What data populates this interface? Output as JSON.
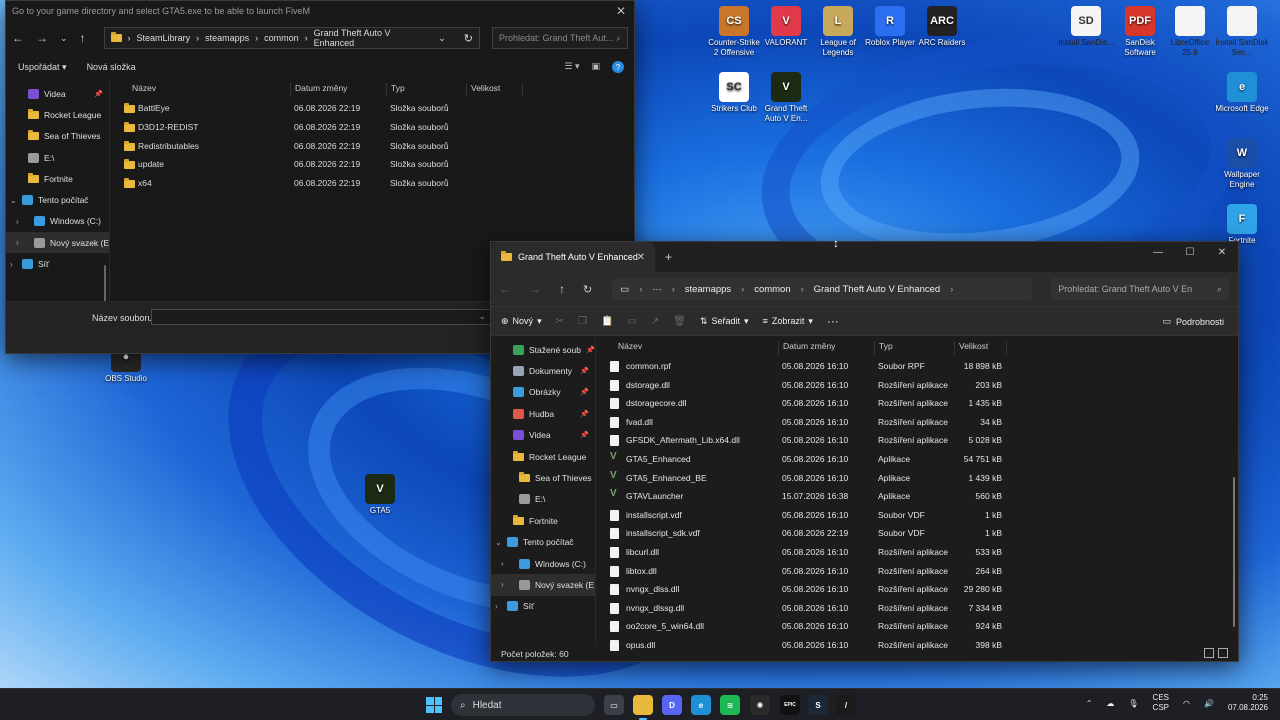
{
  "desktop": {
    "icons": [
      {
        "label": "Counter-Strike 2 Offensive",
        "color": "#c9762a",
        "abbr": "CS"
      },
      {
        "label": "VALORANT",
        "color": "#e0394a",
        "abbr": "V"
      },
      {
        "label": "League of Legends",
        "color": "#c8a85a",
        "abbr": "L"
      },
      {
        "label": "Roblox Player",
        "color": "#2b6ff0",
        "abbr": "R"
      },
      {
        "label": "ARC Raiders",
        "color": "#222222",
        "abbr": "ARC"
      },
      {
        "label": "Install SanDis...",
        "color": "#f5f5f5",
        "abbr": "SD"
      },
      {
        "label": "SanDisk Software",
        "color": "#d8362b",
        "abbr": "PDF"
      },
      {
        "label": "LibreOffice 25.8",
        "color": "#f5f5f5",
        "abbr": ""
      },
      {
        "label": "Install SanDisk Sec...",
        "color": "#f5f5f5",
        "abbr": ""
      },
      {
        "label": "Strikers Club",
        "color": "#ffffff",
        "abbr": "SC"
      },
      {
        "label": "Grand Theft Auto V En...",
        "color": "#1c2a14",
        "abbr": "V"
      },
      {
        "label": "Microsoft Edge",
        "color": "#1f8fd6",
        "abbr": "e"
      },
      {
        "label": "Wallpaper Engine",
        "color": "#1a4fa8",
        "abbr": "W"
      },
      {
        "label": "Fortnite",
        "color": "#2fa4e8",
        "abbr": "F"
      },
      {
        "label": "OBS Studio",
        "color": "#2a2a2a",
        "abbr": "●"
      },
      {
        "label": "GTA5",
        "color": "#1c2a14",
        "abbr": "V"
      }
    ]
  },
  "dialog": {
    "title": "Go to your game directory and select GTA5.exe to be able to launch FiveM",
    "close": "✕",
    "breadcrumb": [
      "SteamLibrary",
      "steamapps",
      "common",
      "Grand Theft Auto V Enhanced"
    ],
    "search_placeholder": "Prohledat: Grand Theft Aut...",
    "organize": "Uspořádat",
    "new_folder": "Nová složka",
    "sidebar": [
      {
        "label": "Videa",
        "color": "#7a4fd6",
        "pin": true
      },
      {
        "label": "Rocket League",
        "folder": true
      },
      {
        "label": "Sea of Thieves",
        "folder": true
      },
      {
        "label": "E:\\",
        "color": "#9a9a9a"
      },
      {
        "label": "Fortnite",
        "folder": true
      },
      {
        "label": "Tento počítač",
        "color": "#3a9be0",
        "top": true
      },
      {
        "label": "Windows (C:)",
        "color": "#3a9be0"
      },
      {
        "label": "Nový svazek (E",
        "color": "#9a9a9a",
        "selected": true
      },
      {
        "label": "Síť",
        "color": "#3a9be0",
        "top": true
      }
    ],
    "columns": [
      "Název",
      "Datum změny",
      "Typ",
      "Velikost"
    ],
    "rows": [
      {
        "name": "BattlEye",
        "date": "06.08.2026 22:19",
        "type": "Složka souborů"
      },
      {
        "name": "D3D12-REDIST",
        "date": "06.08.2026 22:19",
        "type": "Složka souborů"
      },
      {
        "name": "Redistributables",
        "date": "06.08.2026 22:19",
        "type": "Složka souborů"
      },
      {
        "name": "update",
        "date": "06.08.2026 22:19",
        "type": "Složka souborů"
      },
      {
        "name": "x64",
        "date": "06.08.2026 22:19",
        "type": "Složka souborů"
      }
    ],
    "filename_label": "Název souboru:",
    "filename_value": ""
  },
  "explorer": {
    "tab_title": "Grand Theft Auto V Enhanced",
    "breadcrumb": [
      "steamapps",
      "common",
      "Grand Theft Auto V Enhanced"
    ],
    "search_placeholder": "Prohledat: Grand Theft Auto V En",
    "cmd": {
      "new": "Nový",
      "sort": "Seřadit",
      "view": "Zobrazit",
      "details": "Podrobnosti"
    },
    "sidebar": [
      {
        "label": "Stažené soub",
        "color": "#3aa35a",
        "pin": true
      },
      {
        "label": "Dokumenty",
        "color": "#9aa4b8",
        "pin": true
      },
      {
        "label": "Obrázky",
        "color": "#3a9be0",
        "pin": true
      },
      {
        "label": "Hudba",
        "color": "#e05a4a",
        "pin": true
      },
      {
        "label": "Videa",
        "color": "#7a4fd6",
        "pin": true
      },
      {
        "label": "Rocket League",
        "folder": true
      },
      {
        "label": "Sea of Thieves",
        "folder": true
      },
      {
        "label": "E:\\",
        "color": "#9a9a9a"
      },
      {
        "label": "Fortnite",
        "folder": true
      },
      {
        "label": "Tento počítač",
        "color": "#3a9be0",
        "top": true
      },
      {
        "label": "Windows (C:)",
        "color": "#3a9be0"
      },
      {
        "label": "Nový svazek (E",
        "color": "#9a9a9a",
        "selected": true
      },
      {
        "label": "Síť",
        "color": "#3a9be0",
        "top": true
      }
    ],
    "columns": [
      "Název",
      "Datum změny",
      "Typ",
      "Velikost"
    ],
    "rows": [
      {
        "name": "common.rpf",
        "date": "05.08.2026 16:10",
        "type": "Soubor RPF",
        "size": "18 898 kB",
        "icon": "file"
      },
      {
        "name": "dstorage.dll",
        "date": "05.08.2026 16:10",
        "type": "Rozšíření aplikace",
        "size": "203 kB",
        "icon": "file"
      },
      {
        "name": "dstoragecore.dll",
        "date": "05.08.2026 16:10",
        "type": "Rozšíření aplikace",
        "size": "1 435 kB",
        "icon": "file"
      },
      {
        "name": "fvad.dll",
        "date": "05.08.2026 16:10",
        "type": "Rozšíření aplikace",
        "size": "34 kB",
        "icon": "file"
      },
      {
        "name": "GFSDK_Aftermath_Lib.x64.dll",
        "date": "05.08.2026 16:10",
        "type": "Rozšíření aplikace",
        "size": "5 028 kB",
        "icon": "file"
      },
      {
        "name": "GTA5_Enhanced",
        "date": "05.08.2026 16:10",
        "type": "Aplikace",
        "size": "54 751 kB",
        "icon": "gta"
      },
      {
        "name": "GTA5_Enhanced_BE",
        "date": "05.08.2026 16:10",
        "type": "Aplikace",
        "size": "1 439 kB",
        "icon": "gta"
      },
      {
        "name": "GTAVLauncher",
        "date": "15.07.2026 16:38",
        "type": "Aplikace",
        "size": "560 kB",
        "icon": "gta"
      },
      {
        "name": "installscript.vdf",
        "date": "05.08.2026 16:10",
        "type": "Soubor VDF",
        "size": "1 kB",
        "icon": "file"
      },
      {
        "name": "installscript_sdk.vdf",
        "date": "06.08.2026 22:19",
        "type": "Soubor VDF",
        "size": "1 kB",
        "icon": "file"
      },
      {
        "name": "libcurl.dll",
        "date": "05.08.2026 16:10",
        "type": "Rozšíření aplikace",
        "size": "533 kB",
        "icon": "file"
      },
      {
        "name": "libtox.dll",
        "date": "05.08.2026 16:10",
        "type": "Rozšíření aplikace",
        "size": "264 kB",
        "icon": "file"
      },
      {
        "name": "nvngx_dlss.dll",
        "date": "05.08.2026 16:10",
        "type": "Rozšíření aplikace",
        "size": "29 280 kB",
        "icon": "file"
      },
      {
        "name": "nvngx_dlssg.dll",
        "date": "05.08.2026 16:10",
        "type": "Rozšíření aplikace",
        "size": "7 334 kB",
        "icon": "file"
      },
      {
        "name": "oo2core_5_win64.dll",
        "date": "05.08.2026 16:10",
        "type": "Rozšíření aplikace",
        "size": "924 kB",
        "icon": "file"
      },
      {
        "name": "opus.dll",
        "date": "05.08.2026 16:10",
        "type": "Rozšíření aplikace",
        "size": "398 kB",
        "icon": "file"
      }
    ],
    "status": "Počet položek: 60"
  },
  "taskbar": {
    "search": "Hledat",
    "apps": [
      {
        "name": "task-view",
        "color": "#3b3f47",
        "abbr": "▭"
      },
      {
        "name": "file-explorer",
        "color": "#e8b93a",
        "abbr": "",
        "active": true
      },
      {
        "name": "discord",
        "color": "#5865f2",
        "abbr": "D"
      },
      {
        "name": "edge",
        "color": "#1f8fd6",
        "abbr": "e"
      },
      {
        "name": "spotify",
        "color": "#1db954",
        "abbr": "≋"
      },
      {
        "name": "chatgpt",
        "color": "#2a2a2a",
        "abbr": "✺"
      },
      {
        "name": "epic-games",
        "color": "#111111",
        "abbr": "EPIC"
      },
      {
        "name": "steam",
        "color": "#1b2838",
        "abbr": "S"
      },
      {
        "name": "nvidia-app",
        "color": "#1a1a1a",
        "abbr": "/"
      }
    ],
    "lang_top": "CES",
    "lang_bottom": "CSP",
    "time": "0:25",
    "date": "07.08.2026"
  }
}
